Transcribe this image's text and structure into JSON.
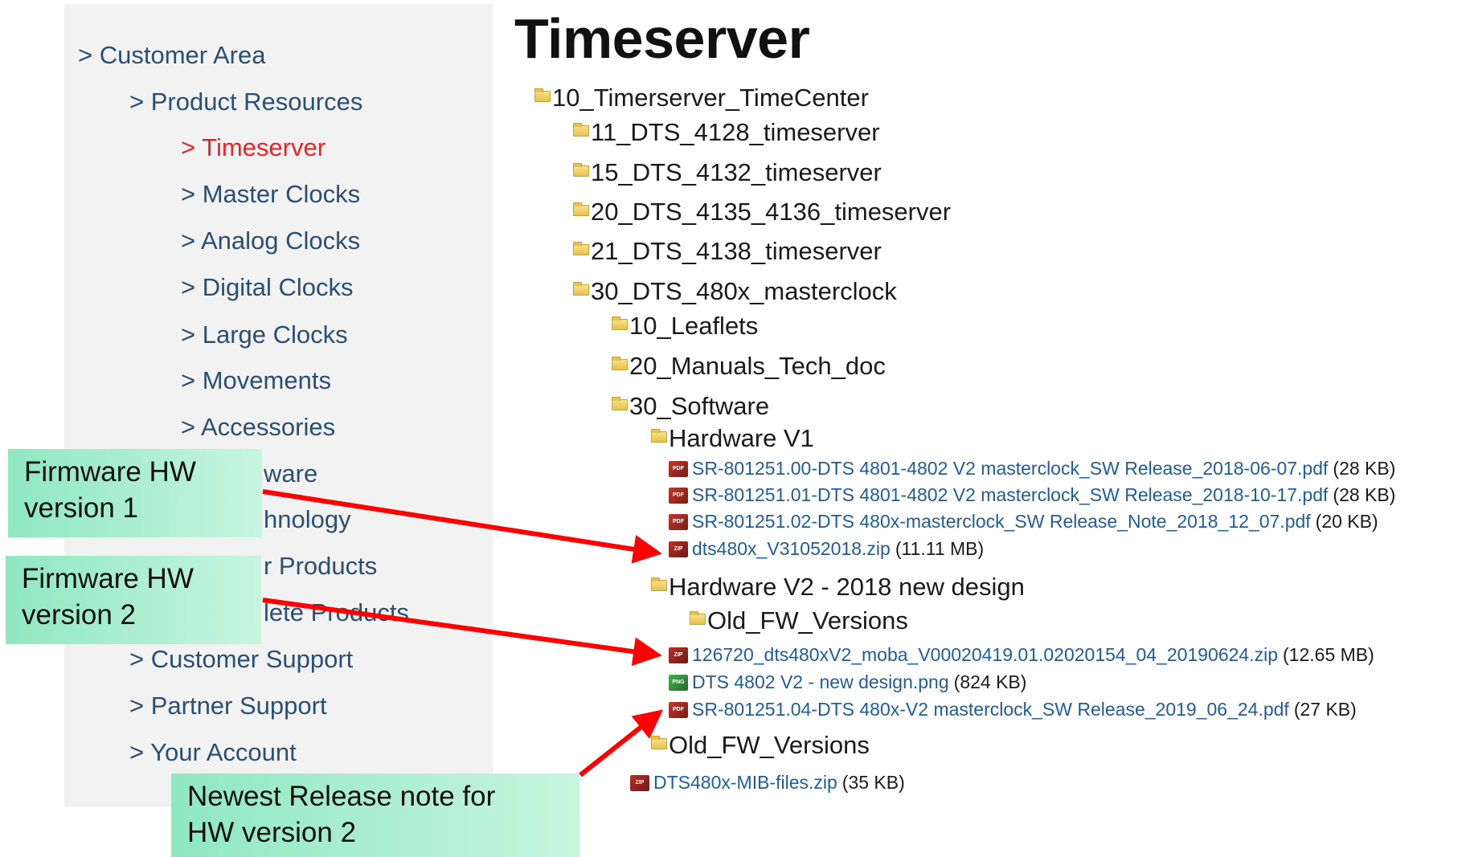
{
  "sidebar": {
    "items": [
      {
        "label": "> Customer Area"
      },
      {
        "label": "> Product Resources"
      },
      {
        "label": "> Timeserver"
      },
      {
        "label": "> Master Clocks"
      },
      {
        "label": "> Analog Clocks"
      },
      {
        "label": "> Digital Clocks"
      },
      {
        "label": "> Large Clocks"
      },
      {
        "label": "> Movements"
      },
      {
        "label": "> Accessories"
      },
      {
        "label": "ware"
      },
      {
        "label": "hnology"
      },
      {
        "label": "r Products"
      },
      {
        "label": "lete Products"
      },
      {
        "label": "> Customer Support"
      },
      {
        "label": "> Partner Support"
      },
      {
        "label": "> Your Account"
      }
    ]
  },
  "page": {
    "title": "Timeserver"
  },
  "tree": {
    "folders": [
      {
        "label": "10_Timerserver_TimeCenter"
      },
      {
        "label": "11_DTS_4128_timeserver"
      },
      {
        "label": "15_DTS_4132_timeserver"
      },
      {
        "label": "20_DTS_4135_4136_timeserver"
      },
      {
        "label": "21_DTS_4138_timeserver"
      },
      {
        "label": "30_DTS_480x_masterclock"
      },
      {
        "label": "10_Leaflets"
      },
      {
        "label": "20_Manuals_Tech_doc"
      },
      {
        "label": "30_Software"
      },
      {
        "label": "Hardware V1"
      },
      {
        "label": "Hardware V2 - 2018 new design"
      },
      {
        "label": "Old_FW_Versions"
      },
      {
        "label": "Old_FW_Versions"
      }
    ],
    "files": [
      {
        "name": "SR-801251.00-DTS 4801-4802 V2 masterclock_SW Release_2018-06-07.pdf",
        "size": "(28 KB)",
        "type": "pdf"
      },
      {
        "name": "SR-801251.01-DTS 4801-4802 V2 masterclock_SW Release_2018-10-17.pdf",
        "size": "(28 KB)",
        "type": "pdf"
      },
      {
        "name": "SR-801251.02-DTS 480x-masterclock_SW Release_Note_2018_12_07.pdf",
        "size": "(20 KB)",
        "type": "pdf"
      },
      {
        "name": "dts480x_V31052018.zip",
        "size": "(11.11 MB)",
        "type": "zip"
      },
      {
        "name": "126720_dts480xV2_moba_V00020419.01.02020154_04_20190624.zip",
        "size": "(12.65 MB)",
        "type": "zip"
      },
      {
        "name": "DTS 4802 V2 - new design.png",
        "size": "(824 KB)",
        "type": "png"
      },
      {
        "name": "SR-801251.04-DTS 480x-V2 masterclock_SW Release_2019_06_24.pdf",
        "size": "(27 KB)",
        "type": "pdf"
      },
      {
        "name": "DTS480x-MIB-files.zip",
        "size": "(35 KB)",
        "type": "zip"
      }
    ]
  },
  "callouts": [
    {
      "line1": "Firmware HW",
      "line2": "version 1"
    },
    {
      "line1": "Firmware HW",
      "line2": "version 2"
    },
    {
      "line1": "Newest Release note for",
      "line2": "HW version 2"
    }
  ],
  "colors": {
    "link": "#1f5c99",
    "nav": "#2b4f73",
    "nav_active": "#e8232a",
    "arrow": "#ff0000",
    "callout": "#8fe8c0"
  }
}
